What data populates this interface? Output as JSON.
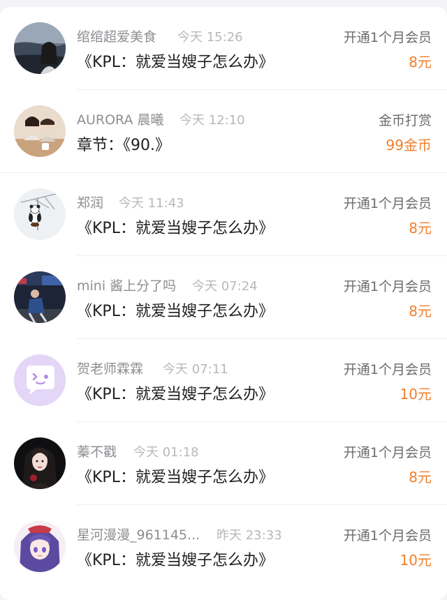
{
  "colors": {
    "accent_amount": "#f07f2c",
    "name_text": "#8e8e93",
    "time_text": "#b8b8bd",
    "title_text": "#1f1f1f",
    "action_text": "#6b6b70"
  },
  "records": [
    {
      "name": "绾绾超爱美食",
      "time": "今天 15:26",
      "title": "《KPL：就爱当嫂子怎么办》",
      "action": "开通1个月会员",
      "amount": "8元",
      "avatar_icon": "avatar-sea-girl"
    },
    {
      "name": "AURORA 晨曦",
      "time": "今天 12:10",
      "title": "章节：《90.》",
      "action": "金币打赏",
      "amount": "99金币",
      "avatar_icon": "avatar-couple-photo"
    },
    {
      "name": "郑润",
      "time": "今天 11:43",
      "title": "《KPL：就爱当嫂子怎么办》",
      "action": "开通1个月会员",
      "amount": "8元",
      "avatar_icon": "avatar-panda-tree"
    },
    {
      "name": "mini 酱上分了吗",
      "time": "今天 07:24",
      "title": "《KPL：就爱当嫂子怎么办》",
      "action": "开通1个月会员",
      "amount": "8元",
      "avatar_icon": "avatar-night-street"
    },
    {
      "name": "贺老师霖霖",
      "time": "今天 07:11",
      "title": "《KPL：就爱当嫂子怎么办》",
      "action": "开通1个月会员",
      "amount": "10元",
      "avatar_icon": "avatar-default-chat-bubble"
    },
    {
      "name": "蓁不戳",
      "time": "今天 01:18",
      "title": "《KPL：就爱当嫂子怎么办》",
      "action": "开通1个月会员",
      "amount": "8元",
      "avatar_icon": "avatar-dark-portrait"
    },
    {
      "name": "星河漫漫_961145...",
      "time": "昨天 23:33",
      "title": "《KPL：就爱当嫂子怎么办》",
      "action": "开通1个月会员",
      "amount": "10元",
      "avatar_icon": "avatar-anime-girl"
    }
  ]
}
